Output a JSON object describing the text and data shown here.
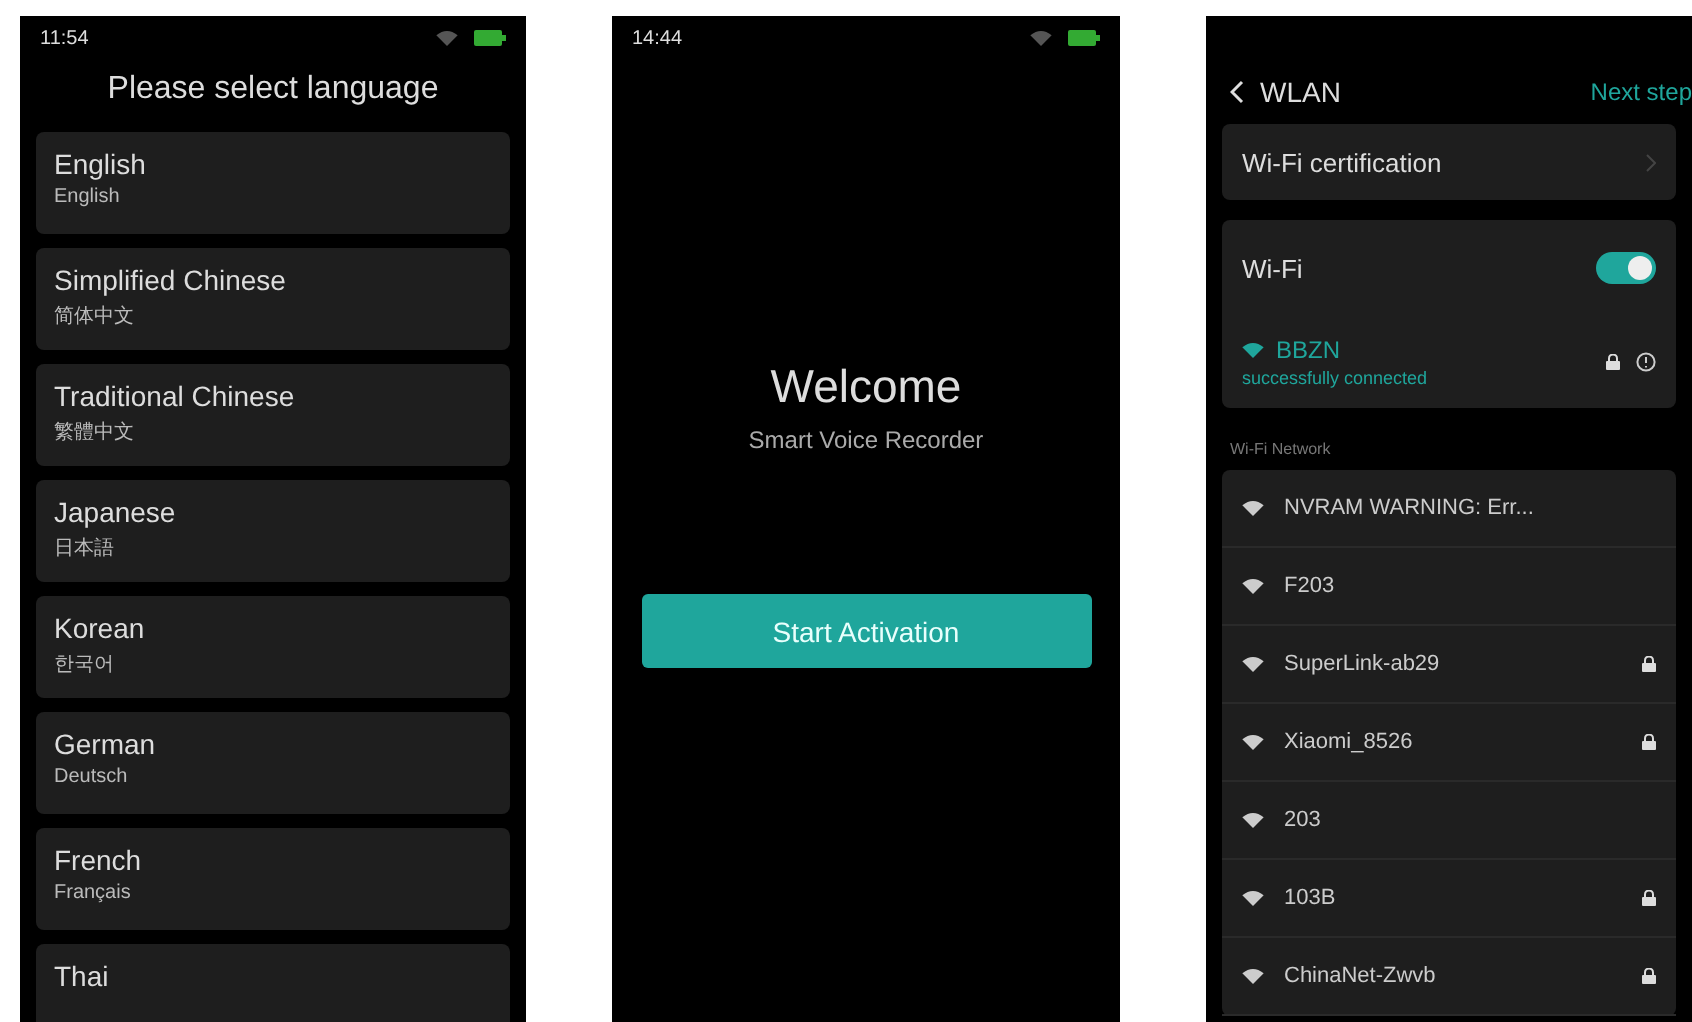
{
  "language_screen": {
    "status_bar": {
      "time": "11:54"
    },
    "title": "Please select language",
    "languages": [
      {
        "name": "English",
        "native": "English"
      },
      {
        "name": "Simplified Chinese",
        "native": "简体中文"
      },
      {
        "name": "Traditional Chinese",
        "native": "繁體中文"
      },
      {
        "name": "Japanese",
        "native": "日本語"
      },
      {
        "name": "Korean",
        "native": "한국어"
      },
      {
        "name": "German",
        "native": "Deutsch"
      },
      {
        "name": "French",
        "native": "Français"
      },
      {
        "name": "Thai"
      }
    ]
  },
  "welcome_screen": {
    "status_bar": {
      "time": "14:44"
    },
    "title": "Welcome",
    "subtitle": "Smart Voice Recorder",
    "button": "Start Activation"
  },
  "wlan_screen": {
    "title": "WLAN",
    "next": "Next step",
    "certification": "Wi-Fi certification",
    "wifi_label": "Wi-Fi",
    "wifi_on": true,
    "connected": {
      "name": "BBZN",
      "status": "successfully connected"
    },
    "section_label": "Wi-Fi Network",
    "networks": [
      {
        "name": "NVRAM WARNING: Err...",
        "locked": false
      },
      {
        "name": "F203",
        "locked": false
      },
      {
        "name": "SuperLink-ab29",
        "locked": true
      },
      {
        "name": "Xiaomi_8526",
        "locked": true
      },
      {
        "name": "203",
        "locked": false
      },
      {
        "name": "103B",
        "locked": true
      },
      {
        "name": "ChinaNet-Zwvb",
        "locked": true
      }
    ]
  }
}
